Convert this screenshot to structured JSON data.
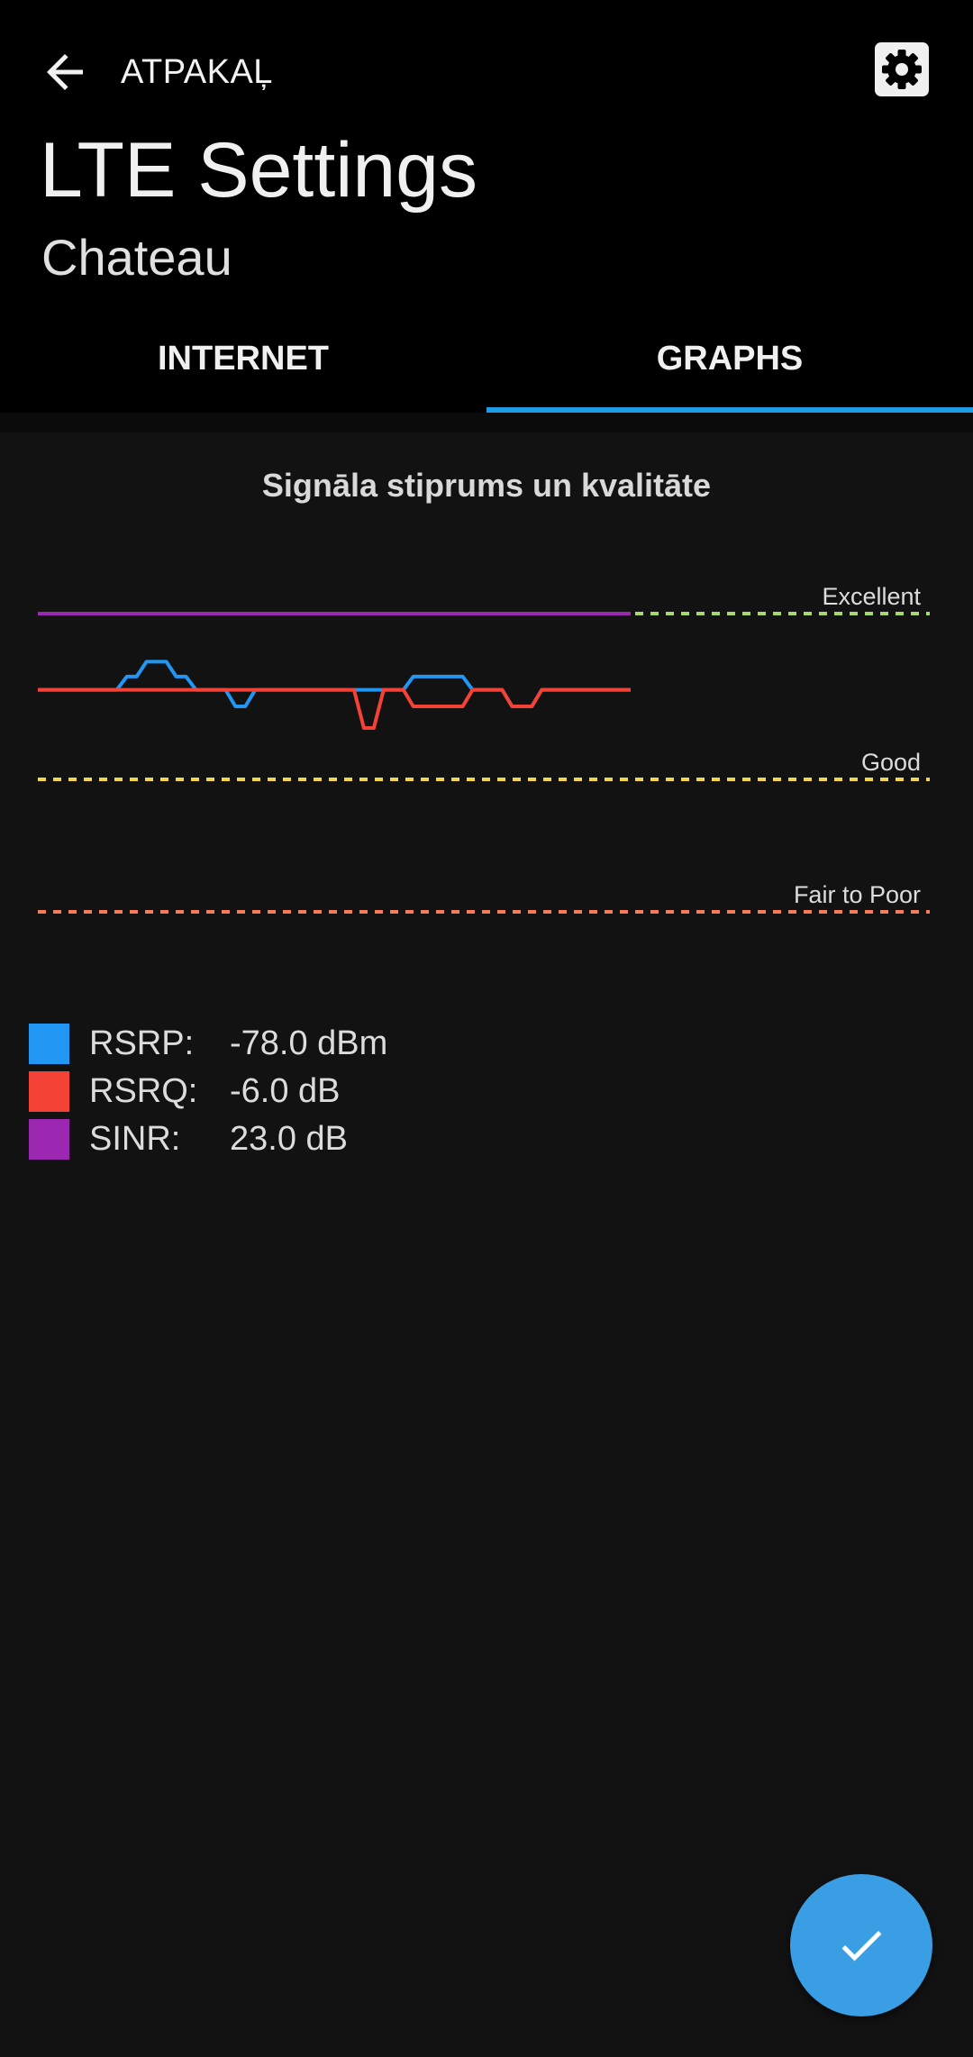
{
  "header": {
    "back_label": "ATPAKAĻ",
    "title": "LTE Settings",
    "subtitle": "Chateau"
  },
  "tabs": [
    {
      "label": "INTERNET",
      "active": false
    },
    {
      "label": "GRAPHS",
      "active": true
    }
  ],
  "icons": {
    "back": "arrow-left-icon",
    "settings": "gear-icon",
    "confirm": "check-icon"
  },
  "colors": {
    "accent": "#1e9be6",
    "rsrp": "#2196f3",
    "rsrq": "#f44336",
    "sinr": "#9c27b0",
    "excellent": "#a6d86a",
    "good": "#f2d64b",
    "fair_to_poor": "#f47c5a",
    "fab": "#3a9ee4"
  },
  "chart_data": {
    "type": "line",
    "title": "Signāla stiprums un kvalitāte",
    "thresholds": [
      {
        "label": "Excellent",
        "level": 1.0
      },
      {
        "label": "Good",
        "level": 0.0
      },
      {
        "label": "Fair to Poor",
        "level": -0.8
      }
    ],
    "series": [
      {
        "name": "RSRP",
        "values": [
          0.54,
          0.54,
          0.54,
          0.54,
          0.54,
          0.54,
          0.54,
          0.54,
          0.54,
          0.62,
          0.62,
          0.71,
          0.71,
          0.71,
          0.62,
          0.62,
          0.54,
          0.54,
          0.54,
          0.54,
          0.44,
          0.44,
          0.54,
          0.54,
          0.54,
          0.54,
          0.54,
          0.54,
          0.54,
          0.54,
          0.54,
          0.54,
          0.54,
          0.54,
          0.54,
          0.54,
          0.54,
          0.54,
          0.62,
          0.62,
          0.62,
          0.62,
          0.62,
          0.62,
          0.54,
          0.54,
          0.54,
          0.54,
          0.44,
          0.44,
          0.44,
          0.54,
          0.54,
          0.54,
          0.54,
          0.54,
          0.54,
          0.54,
          0.54,
          0.54,
          0.54
        ]
      },
      {
        "name": "RSRQ",
        "values": [
          0.54,
          0.54,
          0.54,
          0.54,
          0.54,
          0.54,
          0.54,
          0.54,
          0.54,
          0.54,
          0.54,
          0.54,
          0.54,
          0.54,
          0.54,
          0.54,
          0.54,
          0.54,
          0.54,
          0.54,
          0.54,
          0.54,
          0.54,
          0.54,
          0.54,
          0.54,
          0.54,
          0.54,
          0.54,
          0.54,
          0.54,
          0.54,
          0.54,
          0.31,
          0.31,
          0.54,
          0.54,
          0.54,
          0.44,
          0.44,
          0.44,
          0.44,
          0.44,
          0.44,
          0.54,
          0.54,
          0.54,
          0.54,
          0.44,
          0.44,
          0.44,
          0.54,
          0.54,
          0.54,
          0.54,
          0.54,
          0.54,
          0.54,
          0.54,
          0.54,
          0.54
        ]
      },
      {
        "name": "SINR",
        "values": [
          1.0,
          1.0,
          1.0,
          1.0,
          1.0,
          1.0,
          1.0,
          1.0,
          1.0,
          1.0,
          1.0,
          1.0,
          1.0,
          1.0,
          1.0,
          1.0,
          1.0,
          1.0,
          1.0,
          1.0,
          1.0,
          1.0,
          1.0,
          1.0,
          1.0,
          1.0,
          1.0,
          1.0,
          1.0,
          1.0,
          1.0,
          1.0,
          1.0,
          1.0,
          1.0,
          1.0,
          1.0,
          1.0,
          1.0,
          1.0,
          1.0,
          1.0,
          1.0,
          1.0,
          1.0,
          1.0,
          1.0,
          1.0,
          1.0,
          1.0,
          1.0,
          1.0,
          1.0,
          1.0,
          1.0,
          1.0,
          1.0,
          1.0,
          1.0,
          1.0,
          1.0
        ]
      }
    ],
    "ylim": [
      -1.0,
      1.2
    ],
    "grid": false
  },
  "legend": [
    {
      "name": "RSRP:",
      "value": "-78.0 dBm"
    },
    {
      "name": "RSRQ:",
      "value": "-6.0 dB"
    },
    {
      "name": "SINR:",
      "value": "23.0 dB"
    }
  ]
}
